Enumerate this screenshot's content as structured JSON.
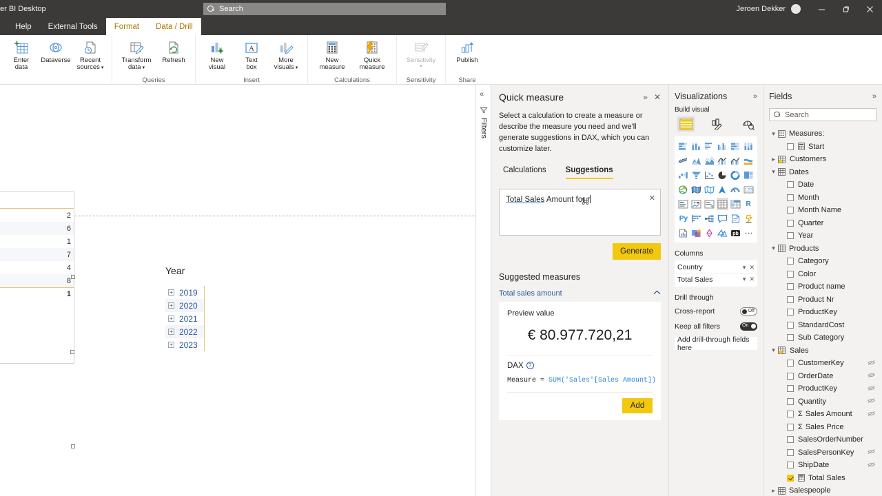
{
  "titlebar": {
    "app_title": "er BI Desktop",
    "search_placeholder": "Search",
    "user_name": "Jeroen Dekker",
    "minimize": "—",
    "restore": "❐",
    "close": "✕"
  },
  "ribbon": {
    "tabs": [
      {
        "label": "Help",
        "contextual": false
      },
      {
        "label": "External Tools",
        "contextual": false
      },
      {
        "label": "Format",
        "contextual": true
      },
      {
        "label": "Data / Drill",
        "contextual": true
      }
    ],
    "groups": [
      {
        "name": "",
        "buttons": [
          {
            "line1": "Enter",
            "line2": "data",
            "icon": "enter-data-icon",
            "disabled": false,
            "caret": false
          },
          {
            "line1": "Dataverse",
            "line2": "",
            "icon": "dataverse-icon",
            "disabled": false,
            "caret": false
          },
          {
            "line1": "Recent",
            "line2": "sources",
            "icon": "recent-sources-icon",
            "disabled": false,
            "caret": true
          }
        ]
      },
      {
        "name": "Queries",
        "buttons": [
          {
            "line1": "Transform",
            "line2": "data",
            "icon": "transform-data-icon",
            "disabled": false,
            "caret": true
          },
          {
            "line1": "Refresh",
            "line2": "",
            "icon": "refresh-icon",
            "disabled": false,
            "caret": false
          }
        ]
      },
      {
        "name": "Insert",
        "buttons": [
          {
            "line1": "New",
            "line2": "visual",
            "icon": "new-visual-icon",
            "disabled": false,
            "caret": false
          },
          {
            "line1": "Text",
            "line2": "box",
            "icon": "text-box-icon",
            "disabled": false,
            "caret": false
          },
          {
            "line1": "More",
            "line2": "visuals",
            "icon": "more-visuals-icon",
            "disabled": false,
            "caret": true
          }
        ]
      },
      {
        "name": "Calculations",
        "buttons": [
          {
            "line1": "New",
            "line2": "measure",
            "icon": "new-measure-icon",
            "disabled": false,
            "caret": false
          },
          {
            "line1": "Quick",
            "line2": "measure",
            "icon": "quick-measure-icon",
            "disabled": false,
            "caret": false
          }
        ]
      },
      {
        "name": "Sensitivity",
        "buttons": [
          {
            "line1": "Sensitivity",
            "line2": "",
            "icon": "sensitivity-icon",
            "disabled": true,
            "caret": true
          }
        ]
      },
      {
        "name": "Share",
        "buttons": [
          {
            "line1": "Publish",
            "line2": "",
            "icon": "publish-icon",
            "disabled": false,
            "caret": false
          }
        ]
      }
    ],
    "collapse_icon": "chevron-up-icon"
  },
  "canvas": {
    "table_visual": {
      "rows": [
        "2",
        "6",
        "1",
        "7",
        "4",
        "8"
      ],
      "total_row": "1",
      "actions": [
        "filter-icon",
        "focus-mode-icon",
        "more-options-icon"
      ]
    },
    "slicer": {
      "title": "Year",
      "items": [
        "2019",
        "2020",
        "2021",
        "2022",
        "2023"
      ],
      "expand_glyph": "+"
    }
  },
  "filters_pane": {
    "collapse_icon": "chevron-double-left-icon",
    "filter_icon": "filter-icon",
    "label": "Filters"
  },
  "quick_measure": {
    "title": "Quick measure",
    "expand_icon": "chevron-double-right-icon",
    "close_icon": "close-icon",
    "description": "Select a calculation to create a measure or describe the measure you need and we'll generate suggestions in DAX, which you can customize later.",
    "tabs": [
      {
        "label": "Calculations",
        "active": false
      },
      {
        "label": "Suggestions",
        "active": true
      }
    ],
    "input": {
      "entity": "Total Sales",
      "rest": " Amount for r",
      "clear_icon": "close-icon"
    },
    "generate_label": "Generate",
    "suggested_header": "Suggested measures",
    "suggestion_name": "Total sales amount",
    "preview_label": "Preview value",
    "preview_value": "€ 80.977.720,21",
    "dax_label": "DAX",
    "dax_help_icon": "help-icon",
    "dax_prefix": "Measure = ",
    "dax_fn": "SUM",
    "dax_args": "('Sales'[Sales Amount])",
    "add_label": "Add"
  },
  "visualizations": {
    "title": "Visualizations",
    "expand_icon": "chevron-double-right-icon",
    "subtitle": "Build visual",
    "modes": [
      {
        "name": "build-visual-icon",
        "selected": true
      },
      {
        "name": "format-visual-icon",
        "selected": false
      },
      {
        "name": "analytics-icon",
        "selected": false
      }
    ],
    "gallery": [
      {
        "name": "stacked-bar-chart-icon",
        "selected": false
      },
      {
        "name": "stacked-column-chart-icon",
        "selected": false
      },
      {
        "name": "clustered-bar-chart-icon",
        "selected": false
      },
      {
        "name": "clustered-column-chart-icon",
        "selected": false
      },
      {
        "name": "100-stacked-bar-chart-icon",
        "selected": false
      },
      {
        "name": "100-stacked-column-chart-icon",
        "selected": false
      },
      {
        "name": "line-chart-icon",
        "selected": false
      },
      {
        "name": "area-chart-icon",
        "selected": false
      },
      {
        "name": "stacked-area-chart-icon",
        "selected": false
      },
      {
        "name": "line-stacked-column-chart-icon",
        "selected": false
      },
      {
        "name": "line-clustered-column-chart-icon",
        "selected": false
      },
      {
        "name": "ribbon-chart-icon",
        "selected": false
      },
      {
        "name": "waterfall-chart-icon",
        "selected": false
      },
      {
        "name": "funnel-chart-icon",
        "selected": false
      },
      {
        "name": "scatter-chart-icon",
        "selected": false
      },
      {
        "name": "pie-chart-icon",
        "selected": false
      },
      {
        "name": "donut-chart-icon",
        "selected": false
      },
      {
        "name": "treemap-icon",
        "selected": false
      },
      {
        "name": "map-icon",
        "selected": false
      },
      {
        "name": "filled-map-icon",
        "selected": false
      },
      {
        "name": "shape-map-icon",
        "selected": false
      },
      {
        "name": "azure-map-icon",
        "selected": false
      },
      {
        "name": "gauge-icon",
        "selected": false
      },
      {
        "name": "card-icon",
        "selected": false
      },
      {
        "name": "multi-row-card-icon",
        "selected": false
      },
      {
        "name": "kpi-icon",
        "selected": false
      },
      {
        "name": "slicer-icon",
        "selected": false
      },
      {
        "name": "table-icon",
        "selected": true
      },
      {
        "name": "matrix-icon",
        "selected": false
      },
      {
        "name": "r-script-visual-icon",
        "selected": false
      },
      {
        "name": "python-visual-icon",
        "selected": false
      },
      {
        "name": "key-influencers-icon",
        "selected": false
      },
      {
        "name": "decomposition-tree-icon",
        "selected": false
      },
      {
        "name": "q-and-a-icon",
        "selected": false
      },
      {
        "name": "narrative-icon",
        "selected": false
      },
      {
        "name": "metrics-icon",
        "selected": false
      },
      {
        "name": "paginated-report-icon",
        "selected": false
      },
      {
        "name": "power-apps-icon",
        "selected": false
      },
      {
        "name": "power-automate-icon",
        "selected": false
      },
      {
        "name": "arcgis-maps-icon",
        "selected": false
      },
      {
        "name": "power-bi-visuals-icon",
        "selected": false
      },
      {
        "name": "more-visuals-icon",
        "selected": false
      }
    ],
    "columns_label": "Columns",
    "columns": [
      "Country",
      "Total Sales"
    ],
    "drill_through_label": "Drill through",
    "cross_report": {
      "label": "Cross-report",
      "state": "Off"
    },
    "keep_all_filters": {
      "label": "Keep all filters",
      "state": "On"
    },
    "drop_zone": "Add drill-through fields here"
  },
  "fields": {
    "title": "Fields",
    "expand_icon": "chevron-double-right-icon",
    "search_placeholder": "Search",
    "tree": [
      {
        "type": "table",
        "label": "Measures:",
        "expanded": true,
        "icon": "measure-table-icon"
      },
      {
        "type": "field",
        "label": "Start",
        "checked": false,
        "measure": true,
        "sigma": false,
        "hidden": false
      },
      {
        "type": "table",
        "label": "Customers",
        "expanded": false,
        "icon": "related-table-icon"
      },
      {
        "type": "table",
        "label": "Dates",
        "expanded": true,
        "icon": "table-icon"
      },
      {
        "type": "field",
        "label": "Date",
        "checked": false,
        "measure": false,
        "sigma": false,
        "hidden": false
      },
      {
        "type": "field",
        "label": "Month",
        "checked": false,
        "measure": false,
        "sigma": false,
        "hidden": false
      },
      {
        "type": "field",
        "label": "Month Name",
        "checked": false,
        "measure": false,
        "sigma": false,
        "hidden": false
      },
      {
        "type": "field",
        "label": "Quarter",
        "checked": false,
        "measure": false,
        "sigma": false,
        "hidden": false
      },
      {
        "type": "field",
        "label": "Year",
        "checked": false,
        "measure": false,
        "sigma": false,
        "hidden": false
      },
      {
        "type": "table",
        "label": "Products",
        "expanded": true,
        "icon": "table-icon"
      },
      {
        "type": "field",
        "label": "Category",
        "checked": false,
        "measure": false,
        "sigma": false,
        "hidden": false
      },
      {
        "type": "field",
        "label": "Color",
        "checked": false,
        "measure": false,
        "sigma": false,
        "hidden": false
      },
      {
        "type": "field",
        "label": "Product name",
        "checked": false,
        "measure": false,
        "sigma": false,
        "hidden": false
      },
      {
        "type": "field",
        "label": "Product Nr",
        "checked": false,
        "measure": false,
        "sigma": false,
        "hidden": false
      },
      {
        "type": "field",
        "label": "ProductKey",
        "checked": false,
        "measure": false,
        "sigma": false,
        "hidden": false
      },
      {
        "type": "field",
        "label": "StandardCost",
        "checked": false,
        "measure": false,
        "sigma": false,
        "hidden": false
      },
      {
        "type": "field",
        "label": "Sub Category",
        "checked": false,
        "measure": false,
        "sigma": false,
        "hidden": false
      },
      {
        "type": "table",
        "label": "Sales",
        "expanded": true,
        "icon": "related-table-icon"
      },
      {
        "type": "field",
        "label": "CustomerKey",
        "checked": false,
        "measure": false,
        "sigma": false,
        "hidden": true
      },
      {
        "type": "field",
        "label": "OrderDate",
        "checked": false,
        "measure": false,
        "sigma": false,
        "hidden": true
      },
      {
        "type": "field",
        "label": "ProductKey",
        "checked": false,
        "measure": false,
        "sigma": false,
        "hidden": true
      },
      {
        "type": "field",
        "label": "Quantity",
        "checked": false,
        "measure": false,
        "sigma": false,
        "hidden": true
      },
      {
        "type": "field",
        "label": "Sales Amount",
        "checked": false,
        "measure": false,
        "sigma": true,
        "hidden": true
      },
      {
        "type": "field",
        "label": "Sales Price",
        "checked": false,
        "measure": false,
        "sigma": true,
        "hidden": false
      },
      {
        "type": "field",
        "label": "SalesOrderNumber",
        "checked": false,
        "measure": false,
        "sigma": false,
        "hidden": false
      },
      {
        "type": "field",
        "label": "SalesPersonKey",
        "checked": false,
        "measure": false,
        "sigma": false,
        "hidden": true
      },
      {
        "type": "field",
        "label": "ShipDate",
        "checked": false,
        "measure": false,
        "sigma": false,
        "hidden": true
      },
      {
        "type": "field",
        "label": "Total Sales",
        "checked": true,
        "measure": true,
        "sigma": false,
        "hidden": false
      },
      {
        "type": "table",
        "label": "Salespeople",
        "expanded": false,
        "icon": "table-icon"
      }
    ]
  },
  "colors": {
    "accent_yellow": "#f2c811",
    "chrome_dark": "#3b3a39",
    "pane_bg": "#f3f2f1",
    "link_blue": "#2b579a",
    "icon_blue": "#2b88d8"
  }
}
